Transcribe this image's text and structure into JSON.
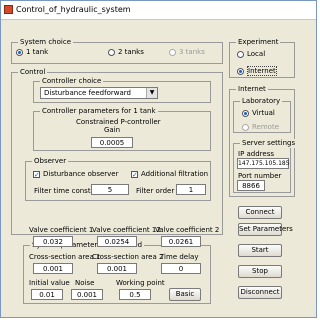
{
  "window": {
    "title": "Control_of_hydraulic_system"
  },
  "system_choice": {
    "legend": "System choice",
    "options": [
      {
        "label": "1 tank",
        "selected": true,
        "enabled": true
      },
      {
        "label": "2 tanks",
        "selected": false,
        "enabled": true
      },
      {
        "label": "3 tanks",
        "selected": false,
        "enabled": false
      }
    ]
  },
  "control": {
    "legend": "Control",
    "controller_choice": {
      "legend": "Controller choice",
      "selected": "Disturbance feedforward"
    },
    "params": {
      "legend": "Controller parameters for 1 tank",
      "heading_line1": "Constrained P-controller",
      "heading_line2": "Gain",
      "gain": "0.0005"
    },
    "observer": {
      "legend": "Observer",
      "disturbance_observer": {
        "label": "Disturbance observer",
        "checked": true
      },
      "additional_filtration": {
        "label": "Additional filtration",
        "checked": true
      },
      "filter_time_constant_label": "Filter time constant",
      "filter_time_constant": "5",
      "filter_order_label": "Filter order",
      "filter_order": "1"
    }
  },
  "system_params": {
    "legend": "System parameters - advanced",
    "vc1_label": "Valve coefficient 1",
    "vc1": "0.032",
    "vc12_label": "Valve coefficient 12",
    "vc12": "0.0254",
    "vc2_label": "Valve coefficient 2",
    "vc2": "0.0261",
    "cs1_label": "Cross-section area 1",
    "cs1": "0.001",
    "cs2_label": "Cross-section area 2",
    "cs2": "0.001",
    "td_label": "Time delay",
    "td": "0",
    "iv_label": "Initial value",
    "iv": "0.01",
    "noise_label": "Noise",
    "noise": "0.001",
    "wp_label": "Working point",
    "wp": "0.5",
    "basic_button": "Basic"
  },
  "experiment": {
    "legend": "Experiment",
    "options": [
      {
        "label": "Local",
        "selected": false
      },
      {
        "label": "Internet",
        "selected": true
      }
    ]
  },
  "internet": {
    "legend": "Internet",
    "laboratory": {
      "legend": "Laboratory",
      "options": [
        {
          "label": "Virtual",
          "selected": true,
          "enabled": true
        },
        {
          "label": "Remote",
          "selected": false,
          "enabled": false
        }
      ]
    },
    "server": {
      "legend": "Server settings",
      "ip_label": "IP address",
      "ip": "147.175.105.185",
      "port_label": "Port number",
      "port": "8866"
    }
  },
  "buttons": {
    "connect": "Connect",
    "set_parameters": "Set Parameters",
    "start": "Start",
    "stop": "Stop",
    "disconnect": "Disconnect"
  }
}
